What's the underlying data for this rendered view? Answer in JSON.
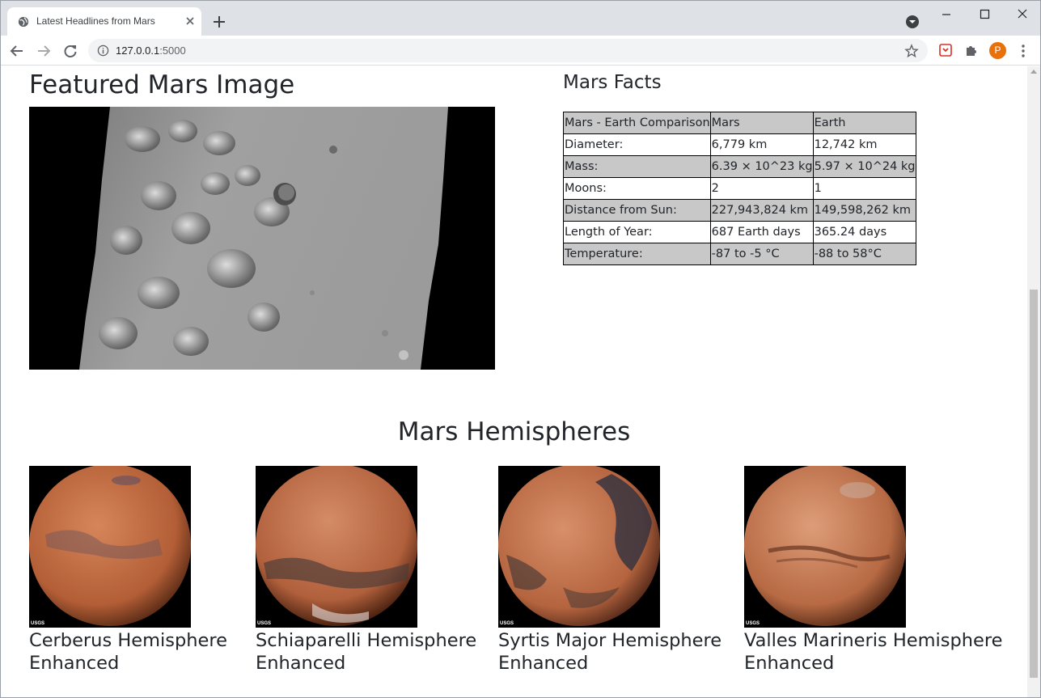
{
  "browser": {
    "tab_title": "Latest Headlines from Mars",
    "url_host": "127.0.0.1",
    "url_port": ":5000",
    "profile_initial": "P"
  },
  "featured": {
    "title": "Featured Mars Image"
  },
  "facts": {
    "title": "Mars Facts",
    "rows": [
      [
        "Mars - Earth Comparison",
        "Mars",
        "Earth"
      ],
      [
        "Diameter:",
        "6,779 km",
        "12,742 km"
      ],
      [
        "Mass:",
        "6.39 × 10^23 kg",
        "5.97 × 10^24 kg"
      ],
      [
        "Moons:",
        "2",
        "1"
      ],
      [
        "Distance from Sun:",
        "227,943,824 km",
        "149,598,262 km"
      ],
      [
        "Length of Year:",
        "687 Earth days",
        "365.24 days"
      ],
      [
        "Temperature:",
        "-87 to -5 °C",
        "-88 to 58°C"
      ]
    ]
  },
  "hemispheres": {
    "title": "Mars Hemispheres",
    "items": [
      {
        "line1": "Cerberus Hemisphere",
        "line2": "Enhanced",
        "logo": "USGS"
      },
      {
        "line1": "Schiaparelli Hemisphere",
        "line2": "Enhanced",
        "logo": "USGS"
      },
      {
        "line1": "Syrtis Major Hemisphere",
        "line2": "Enhanced",
        "logo": "USGS"
      },
      {
        "line1": "Valles Marineris Hemisphere",
        "line2": "Enhanced",
        "logo": "USGS"
      }
    ]
  },
  "colors": {
    "table_shade": "#c8c8c8",
    "tabstrip": "#dee1e6",
    "avatar": "#e8710a"
  }
}
